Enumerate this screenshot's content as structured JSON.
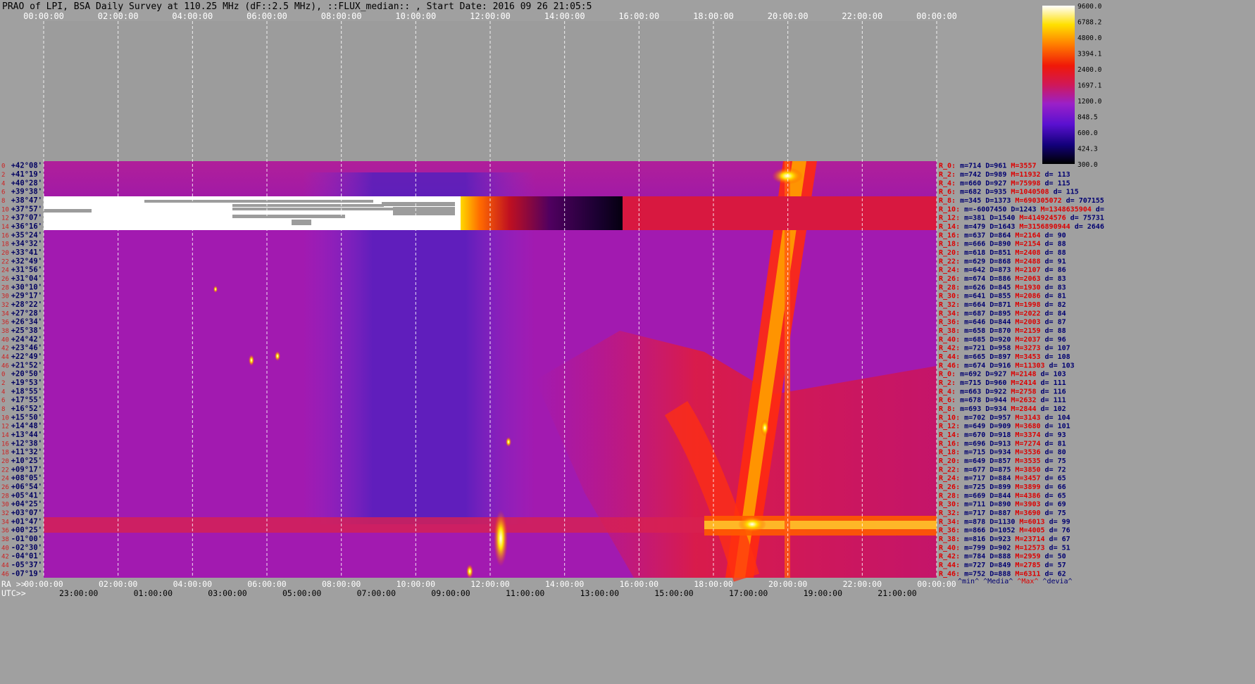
{
  "header": {
    "title": "PRAO of LPI, BSA Daily Survey at 110.25 MHz (dF::2.5 MHz), ::FLUX_median:: , Start Date: 2016 09 26 21:05:5"
  },
  "colors": {
    "background": "#a0a0a0",
    "axis_text": "#ffffff",
    "row_index_text": "#cc2222",
    "dec_text": "#000060",
    "stats_blue": "#000070",
    "stats_red": "#dd0000"
  },
  "chart_data": {
    "type": "heatmap",
    "colormap": "black-blue-purple-red-yellow-white",
    "top_time_ticks": [
      "00:00:00",
      "02:00:00",
      "04:00:00",
      "06:00:00",
      "08:00:00",
      "10:00:00",
      "12:00:00",
      "14:00:00",
      "16:00:00",
      "18:00:00",
      "20:00:00",
      "22:00:00",
      "00:00:00"
    ],
    "bottom_ra_label": "RA >>",
    "bottom_ra_ticks": [
      "00:00:00",
      "02:00:00",
      "04:00:00",
      "06:00:00",
      "08:00:00",
      "10:00:00",
      "12:00:00",
      "14:00:00",
      "16:00:00",
      "18:00:00",
      "20:00:00",
      "22:00:00",
      "00:00:00"
    ],
    "bottom_utc_label": "UTC>>",
    "bottom_utc_ticks": [
      "23:00:00",
      "01:00:00",
      "03:00:00",
      "05:00:00",
      "07:00:00",
      "09:00:00",
      "11:00:00",
      "13:00:00",
      "15:00:00",
      "17:00:00",
      "19:00:00",
      "21:00:00"
    ],
    "colorbar": {
      "ticks": [
        "9600.0",
        "6788.2",
        "4800.0",
        "3394.1",
        "2400.0",
        "1697.1",
        "1200.0",
        "848.5",
        "600.0",
        "424.3",
        "300.0"
      ],
      "min": 300.0,
      "max": 9600.0,
      "scale": "log"
    },
    "row_labels": [
      {
        "i": "0",
        "dec": "+42°08'"
      },
      {
        "i": "2",
        "dec": "+41°19'"
      },
      {
        "i": "4",
        "dec": "+40°28'"
      },
      {
        "i": "6",
        "dec": "+39°38'"
      },
      {
        "i": "8",
        "dec": "+38°47'"
      },
      {
        "i": "10",
        "dec": "+37°57'"
      },
      {
        "i": "12",
        "dec": "+37°07'"
      },
      {
        "i": "14",
        "dec": "+36°16'"
      },
      {
        "i": "16",
        "dec": "+35°24'"
      },
      {
        "i": "18",
        "dec": "+34°32'"
      },
      {
        "i": "20",
        "dec": "+33°41'"
      },
      {
        "i": "22",
        "dec": "+32°49'"
      },
      {
        "i": "24",
        "dec": "+31°56'"
      },
      {
        "i": "26",
        "dec": "+31°04'"
      },
      {
        "i": "28",
        "dec": "+30°10'"
      },
      {
        "i": "30",
        "dec": "+29°17'"
      },
      {
        "i": "32",
        "dec": "+28°22'"
      },
      {
        "i": "34",
        "dec": "+27°28'"
      },
      {
        "i": "36",
        "dec": "+26°34'"
      },
      {
        "i": "38",
        "dec": "+25°38'"
      },
      {
        "i": "40",
        "dec": "+24°42'"
      },
      {
        "i": "42",
        "dec": "+23°46'"
      },
      {
        "i": "44",
        "dec": "+22°49'"
      },
      {
        "i": "46",
        "dec": "+21°52'"
      },
      {
        "i": "0",
        "dec": "+20°50'"
      },
      {
        "i": "2",
        "dec": "+19°53'"
      },
      {
        "i": "4",
        "dec": "+18°55'"
      },
      {
        "i": "6",
        "dec": "+17°55'"
      },
      {
        "i": "8",
        "dec": "+16°52'"
      },
      {
        "i": "10",
        "dec": "+15°50'"
      },
      {
        "i": "12",
        "dec": "+14°48'"
      },
      {
        "i": "14",
        "dec": "+13°44'"
      },
      {
        "i": "16",
        "dec": "+12°38'"
      },
      {
        "i": "18",
        "dec": "+11°32'"
      },
      {
        "i": "20",
        "dec": "+10°25'"
      },
      {
        "i": "22",
        "dec": "+09°17'"
      },
      {
        "i": "24",
        "dec": "+08°05'"
      },
      {
        "i": "26",
        "dec": "+06°54'"
      },
      {
        "i": "28",
        "dec": "+05°41'"
      },
      {
        "i": "30",
        "dec": "+04°25'"
      },
      {
        "i": "32",
        "dec": "+03°07'"
      },
      {
        "i": "34",
        "dec": "+01°47'"
      },
      {
        "i": "36",
        "dec": "+00°25'"
      },
      {
        "i": "38",
        "dec": "-01°00'"
      },
      {
        "i": "40",
        "dec": "-02°30'"
      },
      {
        "i": "42",
        "dec": "-04°01'"
      },
      {
        "i": "44",
        "dec": "-05°37'"
      },
      {
        "i": "46",
        "dec": "-07°19'"
      }
    ],
    "row_stats": [
      {
        "r": "R_0:",
        "m": "m=714",
        "D": "D=961",
        "M": "M=3557",
        "d": ""
      },
      {
        "r": "R_2:",
        "m": "m=742",
        "D": "D=989",
        "M": "M=11932",
        "d": "d= 113"
      },
      {
        "r": "R_4:",
        "m": "m=660",
        "D": "D=927",
        "M": "M=75998",
        "d": "d= 115"
      },
      {
        "r": "R_6:",
        "m": "m=682",
        "D": "D=935",
        "M": "M=1040508",
        "d": "d= 115"
      },
      {
        "r": "R_8:",
        "m": "m=345",
        "D": "D=1373",
        "M": "M=690305072",
        "d": "d= 707155"
      },
      {
        "r": "R_10:",
        "m": "m=-6007450",
        "D": "D=1243",
        "M": "M=1348635904",
        "d": "d="
      },
      {
        "r": "R_12:",
        "m": "m=381",
        "D": "D=1540",
        "M": "M=414924576",
        "d": "d= 75731"
      },
      {
        "r": "R_14:",
        "m": "m=479",
        "D": "D=1643",
        "M": "M=3156890944",
        "d": "d= 2646"
      },
      {
        "r": "R_16:",
        "m": "m=637",
        "D": "D=864",
        "M": "M=2164",
        "d": "d= 90"
      },
      {
        "r": "R_18:",
        "m": "m=666",
        "D": "D=890",
        "M": "M=2154",
        "d": "d= 88"
      },
      {
        "r": "R_20:",
        "m": "m=618",
        "D": "D=851",
        "M": "M=2408",
        "d": "d= 88"
      },
      {
        "r": "R_22:",
        "m": "m=629",
        "D": "D=868",
        "M": "M=2488",
        "d": "d= 91"
      },
      {
        "r": "R_24:",
        "m": "m=642",
        "D": "D=873",
        "M": "M=2107",
        "d": "d= 86"
      },
      {
        "r": "R_26:",
        "m": "m=674",
        "D": "D=886",
        "M": "M=2063",
        "d": "d= 83"
      },
      {
        "r": "R_28:",
        "m": "m=626",
        "D": "D=845",
        "M": "M=1930",
        "d": "d= 83"
      },
      {
        "r": "R_30:",
        "m": "m=641",
        "D": "D=855",
        "M": "M=2086",
        "d": "d= 81"
      },
      {
        "r": "R_32:",
        "m": "m=664",
        "D": "D=871",
        "M": "M=1998",
        "d": "d= 82"
      },
      {
        "r": "R_34:",
        "m": "m=687",
        "D": "D=895",
        "M": "M=2022",
        "d": "d= 84"
      },
      {
        "r": "R_36:",
        "m": "m=646",
        "D": "D=844",
        "M": "M=2003",
        "d": "d= 87"
      },
      {
        "r": "R_38:",
        "m": "m=658",
        "D": "D=870",
        "M": "M=2159",
        "d": "d= 88"
      },
      {
        "r": "R_40:",
        "m": "m=685",
        "D": "D=920",
        "M": "M=2037",
        "d": "d= 96"
      },
      {
        "r": "R_42:",
        "m": "m=721",
        "D": "D=958",
        "M": "M=3273",
        "d": "d= 107"
      },
      {
        "r": "R_44:",
        "m": "m=665",
        "D": "D=897",
        "M": "M=3453",
        "d": "d= 108"
      },
      {
        "r": "R_46:",
        "m": "m=674",
        "D": "D=916",
        "M": "M=11303",
        "d": "d= 103"
      },
      {
        "r": "R_0:",
        "m": "m=692",
        "D": "D=927",
        "M": "M=2148",
        "d": "d= 103"
      },
      {
        "r": "R_2:",
        "m": "m=715",
        "D": "D=960",
        "M": "M=2414",
        "d": "d= 111"
      },
      {
        "r": "R_4:",
        "m": "m=663",
        "D": "D=922",
        "M": "M=2758",
        "d": "d= 116"
      },
      {
        "r": "R_6:",
        "m": "m=678",
        "D": "D=944",
        "M": "M=2632",
        "d": "d= 111"
      },
      {
        "r": "R_8:",
        "m": "m=693",
        "D": "D=934",
        "M": "M=2844",
        "d": "d= 102"
      },
      {
        "r": "R_10:",
        "m": "m=702",
        "D": "D=957",
        "M": "M=3143",
        "d": "d= 104"
      },
      {
        "r": "R_12:",
        "m": "m=649",
        "D": "D=909",
        "M": "M=3680",
        "d": "d= 101"
      },
      {
        "r": "R_14:",
        "m": "m=670",
        "D": "D=918",
        "M": "M=3374",
        "d": "d= 93"
      },
      {
        "r": "R_16:",
        "m": "m=696",
        "D": "D=913",
        "M": "M=7274",
        "d": "d= 81"
      },
      {
        "r": "R_18:",
        "m": "m=715",
        "D": "D=934",
        "M": "M=3536",
        "d": "d= 80"
      },
      {
        "r": "R_20:",
        "m": "m=649",
        "D": "D=857",
        "M": "M=3535",
        "d": "d= 75"
      },
      {
        "r": "R_22:",
        "m": "m=677",
        "D": "D=875",
        "M": "M=3850",
        "d": "d= 72"
      },
      {
        "r": "R_24:",
        "m": "m=717",
        "D": "D=884",
        "M": "M=3457",
        "d": "d= 65"
      },
      {
        "r": "R_26:",
        "m": "m=725",
        "D": "D=899",
        "M": "M=3899",
        "d": "d= 66"
      },
      {
        "r": "R_28:",
        "m": "m=669",
        "D": "D=844",
        "M": "M=4386",
        "d": "d= 65"
      },
      {
        "r": "R_30:",
        "m": "m=711",
        "D": "D=890",
        "M": "M=3903",
        "d": "d= 69"
      },
      {
        "r": "R_32:",
        "m": "m=717",
        "D": "D=887",
        "M": "M=3690",
        "d": "d= 75"
      },
      {
        "r": "R_34:",
        "m": "m=878",
        "D": "D=1130",
        "M": "M=6013",
        "d": "d= 99"
      },
      {
        "r": "R_36:",
        "m": "m=866",
        "D": "D=1052",
        "M": "M=4005",
        "d": "d= 76"
      },
      {
        "r": "R_38:",
        "m": "m=816",
        "D": "D=923",
        "M": "M=23714",
        "d": "d= 67"
      },
      {
        "r": "R_40:",
        "m": "m=799",
        "D": "D=902",
        "M": "M=12573",
        "d": "d= 51"
      },
      {
        "r": "R_42:",
        "m": "m=784",
        "D": "D=888",
        "M": "M=2959",
        "d": "d= 50"
      },
      {
        "r": "R_44:",
        "m": "m=727",
        "D": "D=849",
        "M": "M=2785",
        "d": "d= 57"
      },
      {
        "r": "R_46:",
        "m": "m=752",
        "D": "D=888",
        "M": "M=6311",
        "d": "d= 62"
      }
    ],
    "stats_footer": {
      "min": "^min^",
      "media": "^Media^",
      "max": "^Max^",
      "devia": "^devia^"
    }
  }
}
